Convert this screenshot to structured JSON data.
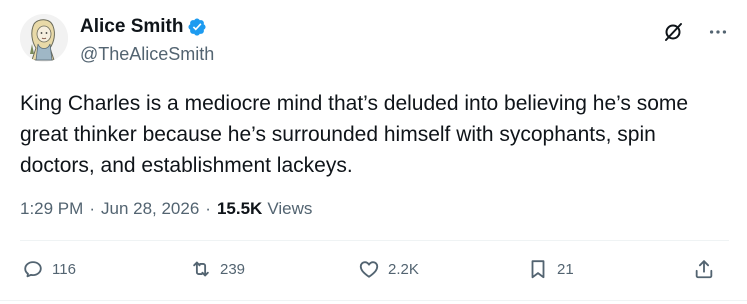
{
  "author": {
    "display_name": "Alice Smith",
    "handle": "@TheAliceSmith",
    "verified_icon": "verified-badge-icon",
    "verified_color": "#1d9bf0"
  },
  "tweet": {
    "text": "King Charles is a mediocre mind that’s deluded into believing he’s some great thinker because he’s surrounded himself with sycophants, spin doctors, and establishment lackeys.",
    "time": "1:29 PM",
    "separator": "·",
    "date": "Jun 28, 2026",
    "views_count": "15.5K",
    "views_label": "Views"
  },
  "top_actions": {
    "grok_icon": "grok-icon",
    "more_icon": "more-icon"
  },
  "actions": {
    "reply_count": "116",
    "retweet_count": "239",
    "like_count": "2.2K",
    "bookmark_count": "21",
    "share_icon": "share-icon"
  },
  "colors": {
    "text_primary": "#0f1419",
    "text_secondary": "#536471",
    "divider": "#eff3f4"
  }
}
